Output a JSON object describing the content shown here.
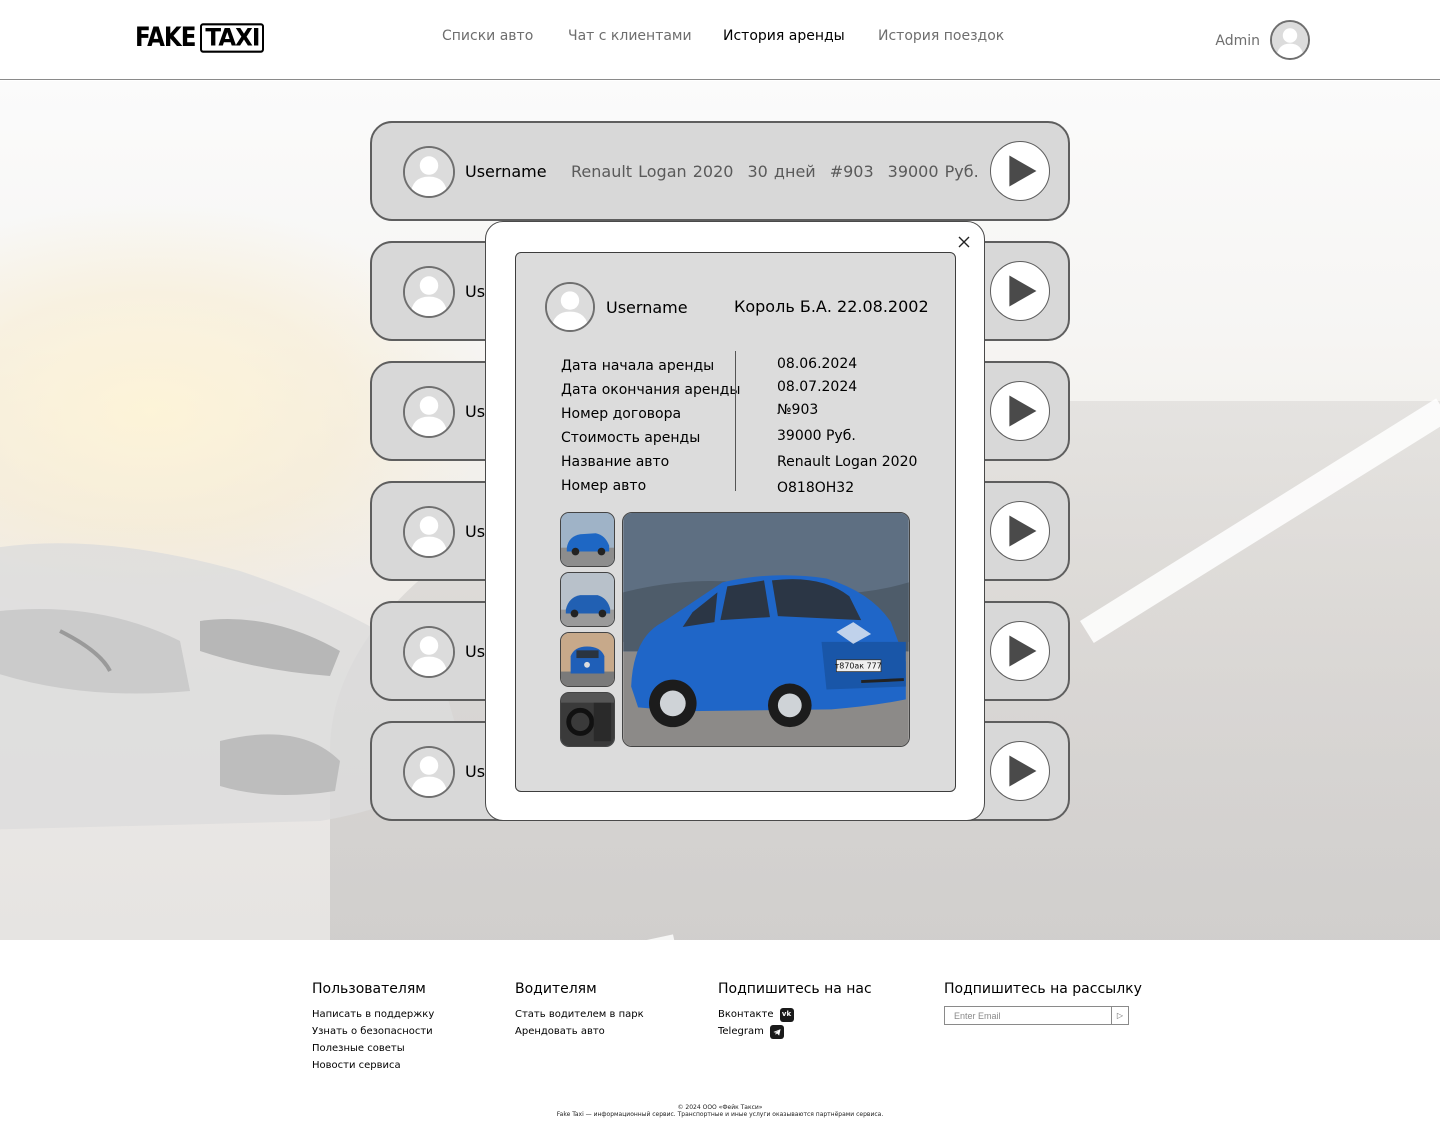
{
  "header": {
    "logo_word1": "FAKE",
    "logo_word2": "TAXI",
    "nav": [
      {
        "label": "Списки авто",
        "active": false
      },
      {
        "label": "Чат с клиентами",
        "active": false
      },
      {
        "label": "История аренды",
        "active": true
      },
      {
        "label": "История поездок",
        "active": false
      }
    ],
    "user_name": "Admin",
    "avatar_icon": "user-avatar-icon"
  },
  "rentals": [
    {
      "username": "Username",
      "car": "Renault Logan 2020",
      "duration": "30 дней",
      "contract": "#903",
      "price": "39000 Руб."
    },
    {
      "username": "Username"
    },
    {
      "username": "Username"
    },
    {
      "username": "Username"
    },
    {
      "username": "Username"
    },
    {
      "username": "Username"
    }
  ],
  "modal": {
    "username": "Username",
    "person": "Король Б.А. 22.08.2002",
    "details": {
      "labels": [
        "Дата начала аренды",
        "Дата окончания аренды",
        "Номер договора",
        "Стоимость аренды",
        "Название авто",
        "Номер авто"
      ],
      "values": [
        "08.06.2024",
        "08.07.2024",
        "№903",
        "39000 Руб.",
        "Renault Logan 2020",
        "О818ОН32"
      ]
    },
    "plate_text": "т870ак 777",
    "close_icon": "close-icon"
  },
  "footer": {
    "users": {
      "title": "Пользователям",
      "links": [
        "Написать в поддержку",
        "Узнать о безопасности",
        "Полезные советы",
        "Новости сервиса"
      ]
    },
    "drivers": {
      "title": "Водителям",
      "links": [
        "Стать водителем в парк",
        "Арендовать авто"
      ]
    },
    "follow": {
      "title": "Подпишитесь на нас",
      "vk": "Вконтакте",
      "vk_icon": "vk-icon",
      "telegram": "Telegram",
      "telegram_icon": "telegram-icon"
    },
    "newsletter": {
      "title": "Подпишитесь на рассылку",
      "placeholder": "Enter Email",
      "send_icon": "send-icon"
    },
    "copyright": "© 2024 ООО «Фейк Такси»",
    "disclaimer": "Fake Taxi — информационный сервис. Транспортные и иные услуги оказываются партнёрами сервиса."
  }
}
